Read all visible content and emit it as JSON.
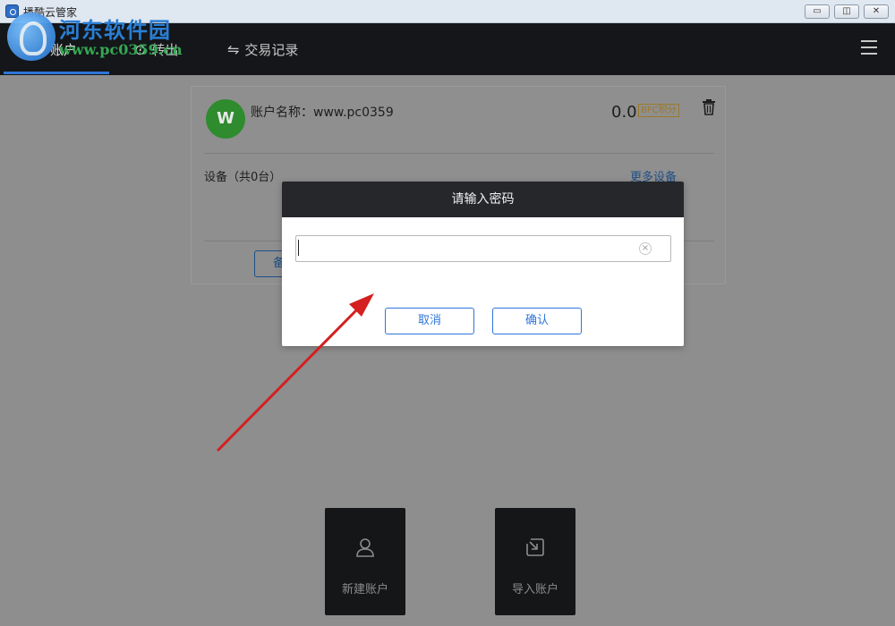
{
  "window": {
    "title": "播酷云管家",
    "min_glyph": "▭",
    "max_glyph": "◫",
    "close_glyph": "✕"
  },
  "watermark": {
    "title": "河东软件园",
    "url": "www.pc0359.cn"
  },
  "nav": {
    "tabs": [
      {
        "label": "账户",
        "icon": "wallet-icon"
      },
      {
        "label": "转出",
        "icon": "transfer-out-icon",
        "glyph": "⊙"
      },
      {
        "label": "交易记录",
        "icon": "swap-icon",
        "glyph": "⇋"
      }
    ],
    "menu_icon": "hamburger-menu-icon"
  },
  "account": {
    "avatar_letter": "W",
    "name_label": "账户名称：www.pc0359",
    "balance": "0.0",
    "unit_tag": "BFC积分",
    "devices_label": "设备（共0台）",
    "more_devices": "更多设备",
    "card_button": "备"
  },
  "actions": {
    "new_account": "新建账户",
    "import_account": "导入账户"
  },
  "modal": {
    "title": "请输入密码",
    "input_value": "",
    "clear_glyph": "×",
    "cancel": "取消",
    "confirm": "确认"
  },
  "colors": {
    "accent": "#2f76d8",
    "nav_bg": "#141619",
    "annotation": "#d42020"
  }
}
